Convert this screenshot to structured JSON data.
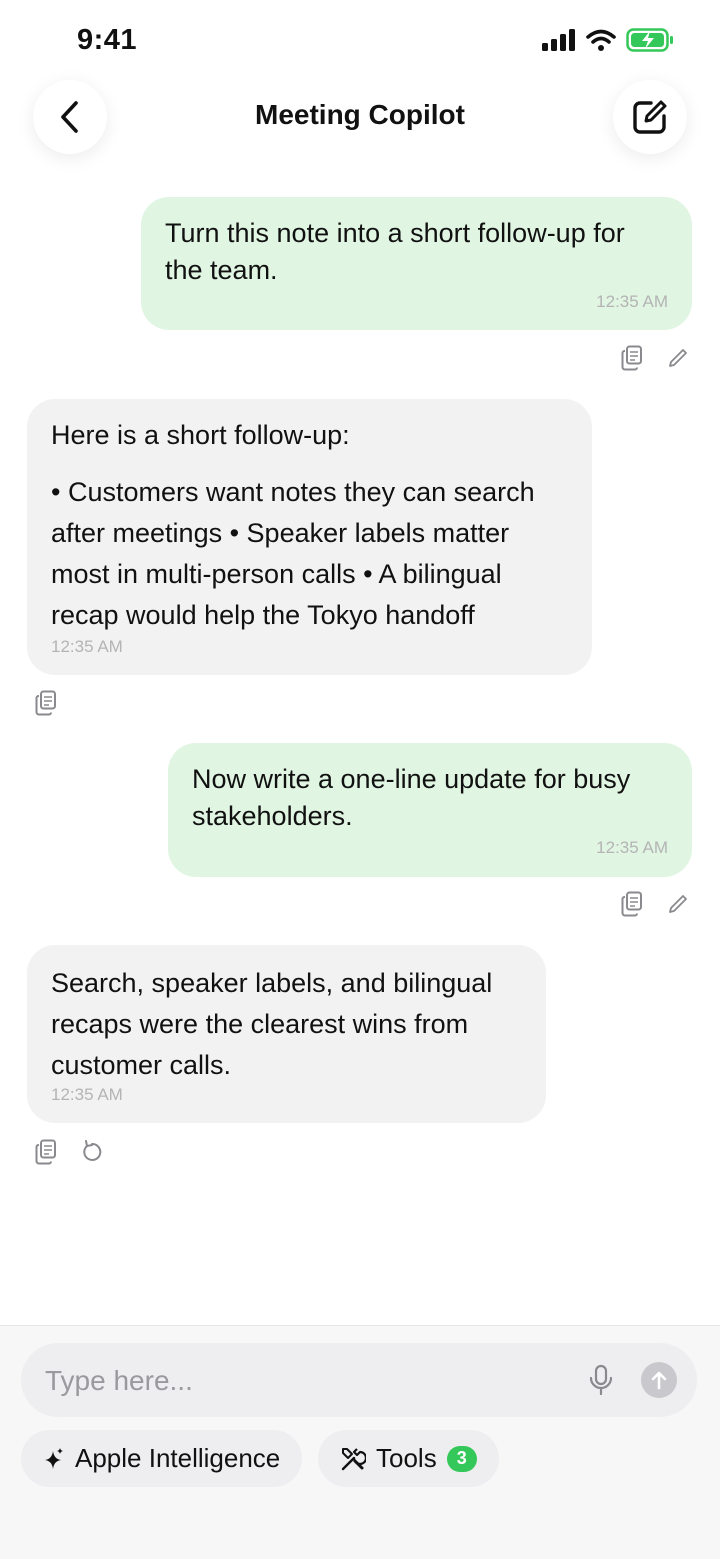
{
  "status_bar": {
    "time": "9:41"
  },
  "header": {
    "title": "Meeting Copilot"
  },
  "messages": [
    {
      "role": "user",
      "text": "Turn this note into a short follow-up for the team.",
      "time": "12:35 AM"
    },
    {
      "role": "assistant",
      "intro": "Here is a short follow-up:",
      "text": "• Customers want notes they can search after meetings • Speaker labels matter most in multi-person calls • A bilingual recap would help the Tokyo handoff",
      "time": "12:35 AM"
    },
    {
      "role": "user",
      "text": "Now write a one-line update for busy stakeholders.",
      "time": "12:35 AM"
    },
    {
      "role": "assistant",
      "text": "Search, speaker labels, and bilingual recaps were the clearest wins from customer calls.",
      "time": "12:35 AM"
    }
  ],
  "composer": {
    "placeholder": "Type here..."
  },
  "chips": [
    {
      "label": "Apple Intelligence",
      "icon": "sparkle-icon"
    },
    {
      "label": "Tools",
      "icon": "tools-icon",
      "badge": "3"
    }
  ],
  "colors": {
    "user_bubble": "#e1f5e3",
    "assistant_bubble": "#f2f2f3",
    "badge": "#34c759",
    "battery": "#34c759"
  }
}
